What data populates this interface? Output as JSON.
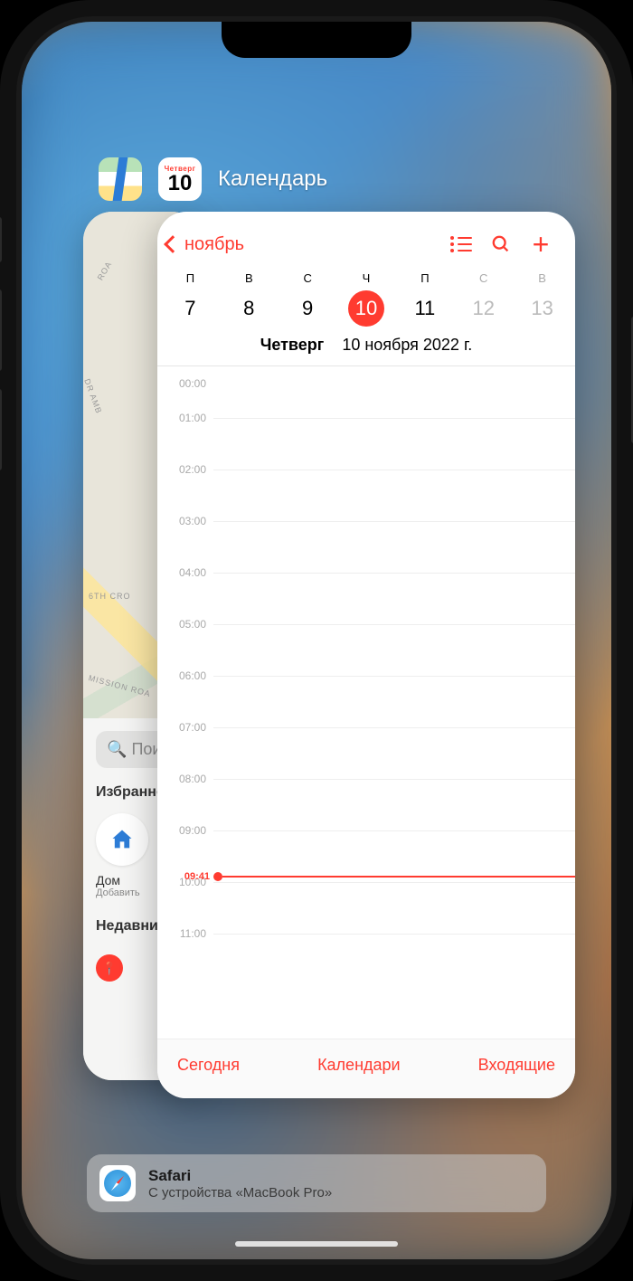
{
  "switcher": {
    "front_app_title": "Календарь",
    "cal_icon": {
      "dow": "Четверг",
      "dom": "10"
    }
  },
  "maps": {
    "search_placeholder": "Поиск",
    "favorites_label": "Избранное",
    "home_label": "Дом",
    "home_sub": "Добавить",
    "recents_label": "Недавние",
    "roads": {
      "r1": "ROA",
      "r2": "DR AMB",
      "r3": "6TH CRO",
      "r4": "MISSION ROA"
    }
  },
  "calendar": {
    "back_label": "ноябрь",
    "weekdays": [
      "П",
      "В",
      "С",
      "Ч",
      "П",
      "С",
      "В"
    ],
    "dates": [
      "7",
      "8",
      "9",
      "10",
      "11",
      "12",
      "13"
    ],
    "selected_index": 3,
    "weekend_indexes": [
      5,
      6
    ],
    "subtitle_dow": "Четверг",
    "subtitle_date": "10 ноября 2022 г.",
    "hours": [
      "00:00",
      "01:00",
      "02:00",
      "03:00",
      "04:00",
      "05:00",
      "06:00",
      "07:00",
      "08:00",
      "09:00",
      "10:00",
      "11:00"
    ],
    "now_time": "09:41",
    "footer": {
      "today": "Сегодня",
      "calendars": "Календари",
      "inbox": "Входящие"
    }
  },
  "handoff": {
    "app": "Safari",
    "source": "С устройства «MacBook Pro»"
  }
}
